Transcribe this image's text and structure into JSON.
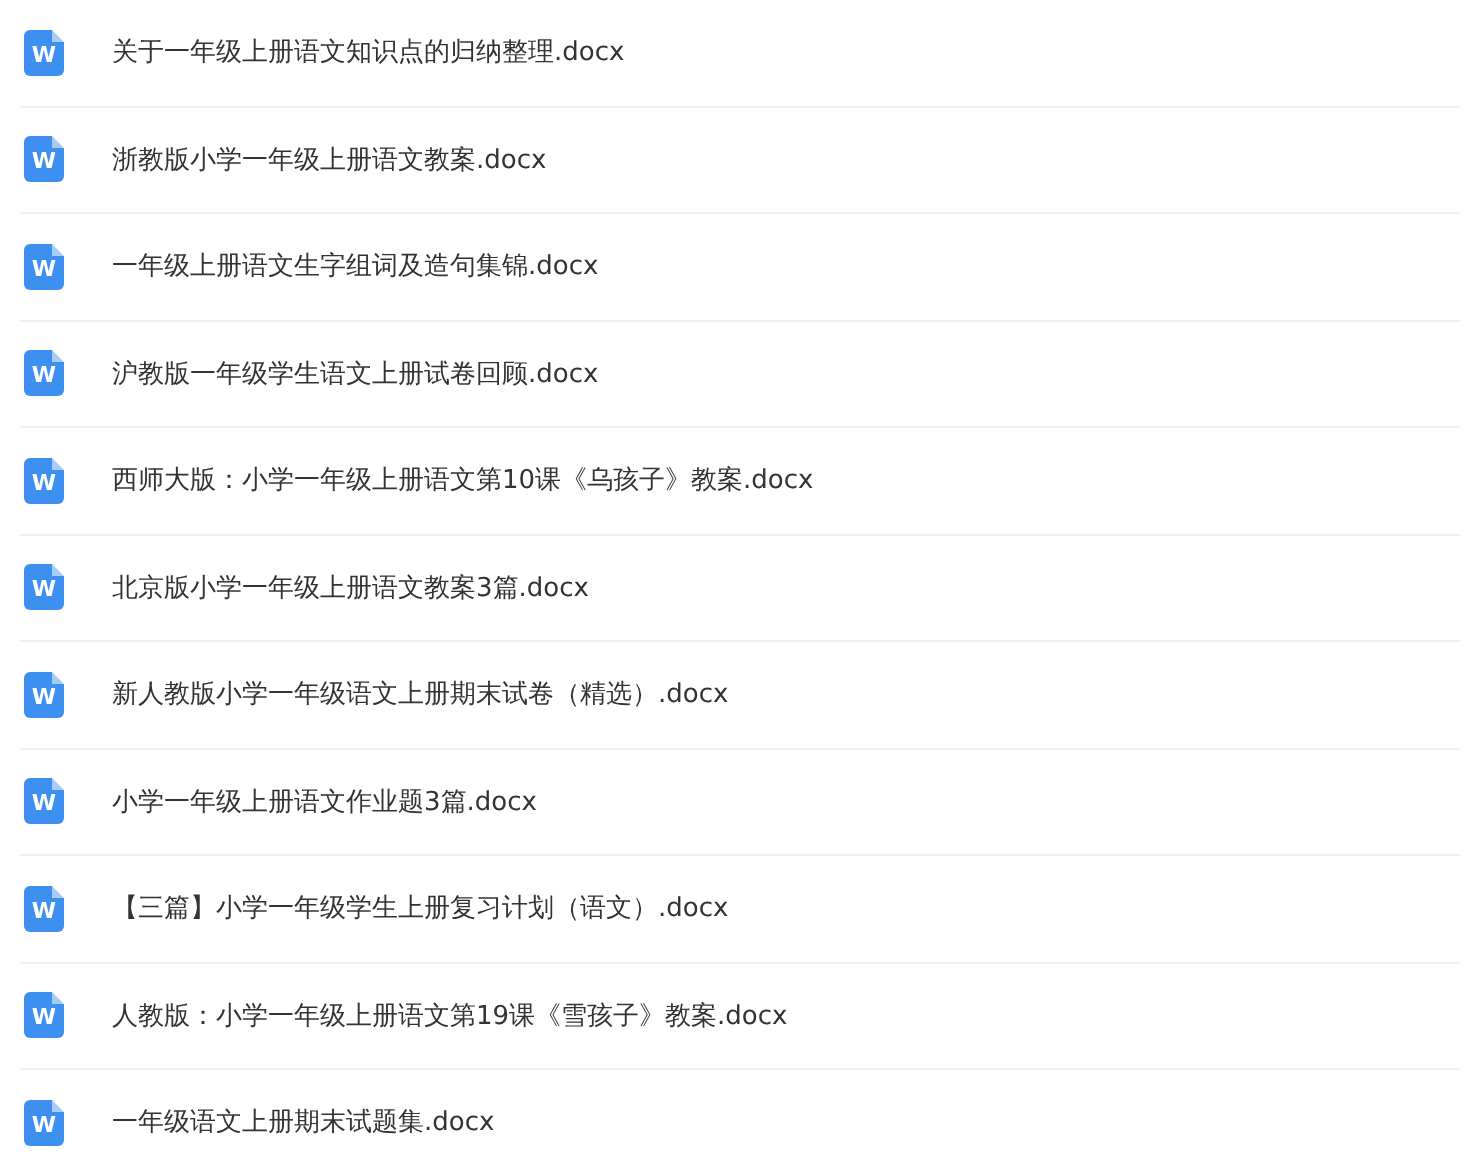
{
  "files": [
    {
      "icon_label": "W",
      "name": "关于一年级上册语文知识点的归纳整理.docx"
    },
    {
      "icon_label": "W",
      "name": "浙教版小学一年级上册语文教案.docx"
    },
    {
      "icon_label": "W",
      "name": "一年级上册语文生字组词及造句集锦.docx"
    },
    {
      "icon_label": "W",
      "name": "沪教版一年级学生语文上册试卷回顾.docx"
    },
    {
      "icon_label": "W",
      "name": "西师大版：小学一年级上册语文第10课《乌孩子》教案.docx"
    },
    {
      "icon_label": "W",
      "name": "北京版小学一年级上册语文教案3篇.docx"
    },
    {
      "icon_label": "W",
      "name": "新人教版小学一年级语文上册期末试卷（精选）.docx"
    },
    {
      "icon_label": "W",
      "name": "小学一年级上册语文作业题3篇.docx"
    },
    {
      "icon_label": "W",
      "name": "【三篇】小学一年级学生上册复习计划（语文）.docx"
    },
    {
      "icon_label": "W",
      "name": "人教版：小学一年级上册语文第19课《雪孩子》教案.docx"
    },
    {
      "icon_label": "W",
      "name": "一年级语文上册期末试题集.docx"
    }
  ]
}
